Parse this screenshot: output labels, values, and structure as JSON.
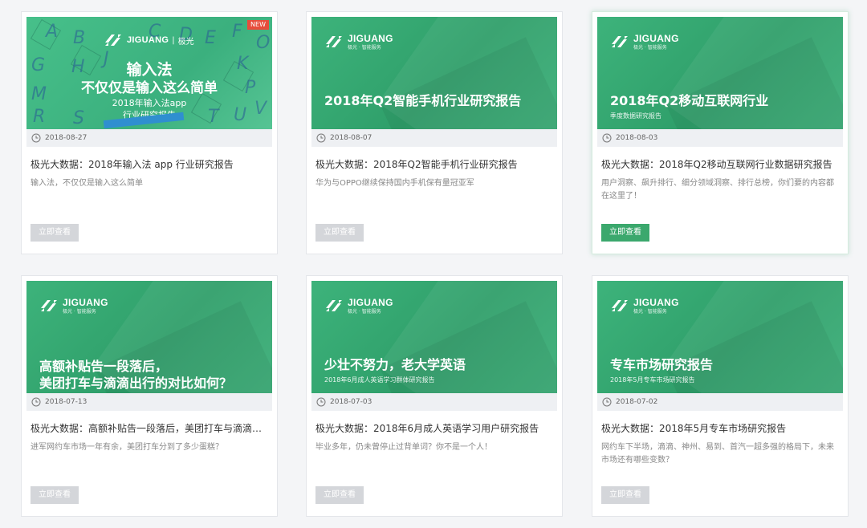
{
  "cards": [
    {
      "banner": {
        "brand": "JIGUANG",
        "brand_cn": "极光",
        "badge": "NEW",
        "title_line1": "输入法",
        "title_line2": "不仅仅是输入这么简单",
        "sub_line1": "2018年输入法app",
        "sub_line2": "行业研究报告",
        "letters": [
          "A",
          "B",
          "C",
          "D",
          "E",
          "F",
          "G",
          "H",
          "J",
          "K",
          "M",
          "O",
          "P",
          "R",
          "S",
          "T",
          "U",
          "V"
        ]
      },
      "date": "2018-08-27",
      "title": "极光大数据：2018年输入法 app 行业研究报告",
      "description": "输入法，不仅仅是输入这么简单",
      "button": "立即查看",
      "button_active": false
    },
    {
      "banner": {
        "brand": "JIGUANG",
        "brand_sub": "极光 · 智能服务",
        "title_line1": "2018年Q2智能手机行业研究报告",
        "title_line2": "",
        "sub": ""
      },
      "date": "2018-08-07",
      "title": "极光大数据：2018年Q2智能手机行业研究报告",
      "description": "华为与OPPO继续保持国内手机保有量冠亚军",
      "button": "立即查看",
      "button_active": false
    },
    {
      "banner": {
        "brand": "JIGUANG",
        "brand_sub": "极光 · 智能服务",
        "title_line1": "2018年Q2移动互联网行业",
        "title_line2": "",
        "sub": "季度数据研究报告"
      },
      "date": "2018-08-03",
      "title": "极光大数据：2018年Q2移动互联网行业数据研究报告",
      "description": "用户洞察、飙升排行、细分领域洞察、排行总榜，你们要的内容都在这里了！",
      "button": "立即查看",
      "button_active": true
    },
    {
      "banner": {
        "brand": "JIGUANG",
        "brand_sub": "极光 · 智能服务",
        "title_line1": "高额补贴告一段落后，",
        "title_line2": "美团打车与滴滴出行的对比如何？",
        "sub": ""
      },
      "date": "2018-07-13",
      "title": "极光大数据：高额补贴告一段落后，美团打车与滴滴出行的对比如何？",
      "description": "进军网约车市场一年有余，美团打车分到了多少蛋糕？",
      "button": "立即查看",
      "button_active": false
    },
    {
      "banner": {
        "brand": "JIGUANG",
        "brand_sub": "极光 · 智能服务",
        "title_line1": "少壮不努力，老大学英语",
        "title_line2": "",
        "sub": "2018年6月成人英语学习群体研究报告"
      },
      "date": "2018-07-03",
      "title": "极光大数据：2018年6月成人英语学习用户研究报告",
      "description": "毕业多年，仍未曾停止过背单词？你不是一个人！",
      "button": "立即查看",
      "button_active": false
    },
    {
      "banner": {
        "brand": "JIGUANG",
        "brand_sub": "极光 · 智能服务",
        "title_line1": "专车市场研究报告",
        "title_line2": "",
        "sub": "2018年5月专车市场研究报告"
      },
      "date": "2018-07-02",
      "title": "极光大数据：2018年5月专车市场研究报告",
      "description": "网约车下半场，滴滴、神州、易到、首汽一超多强的格局下，未来市场还有哪些变数？",
      "button": "立即查看",
      "button_active": false
    }
  ],
  "colors": {
    "brand_green": "#3ba86d",
    "banner_green": "#36a971",
    "button_disabled": "#d4d6da",
    "badge_red": "#e74c3c"
  },
  "icons": {
    "date": "clock-icon",
    "logo": "jiguang-logo-icon"
  }
}
